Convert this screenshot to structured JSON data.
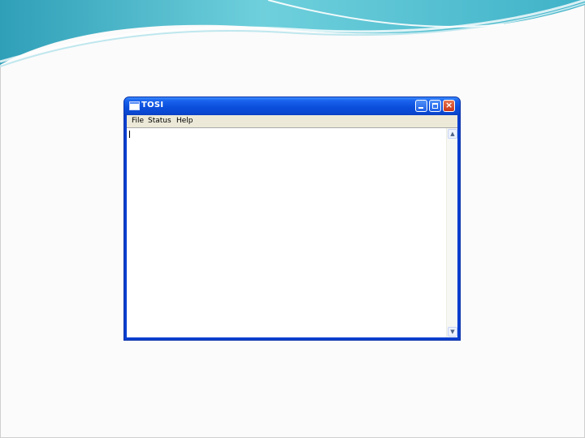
{
  "window": {
    "title": "TOSI",
    "menu": [
      "File",
      "Status",
      "Help"
    ]
  },
  "icons": {
    "app": "notepad-window-icon",
    "minimize": "minimize-icon",
    "maximize": "maximize-icon",
    "close": "close-icon",
    "scroll_up": "chevron-up-icon",
    "scroll_down": "chevron-down-icon"
  },
  "colors": {
    "title_bar": "#0a48d2",
    "close_button": "#c9371a",
    "menu_bar": "#ece9d8",
    "swoosh_teal": "#5cc3d3"
  }
}
